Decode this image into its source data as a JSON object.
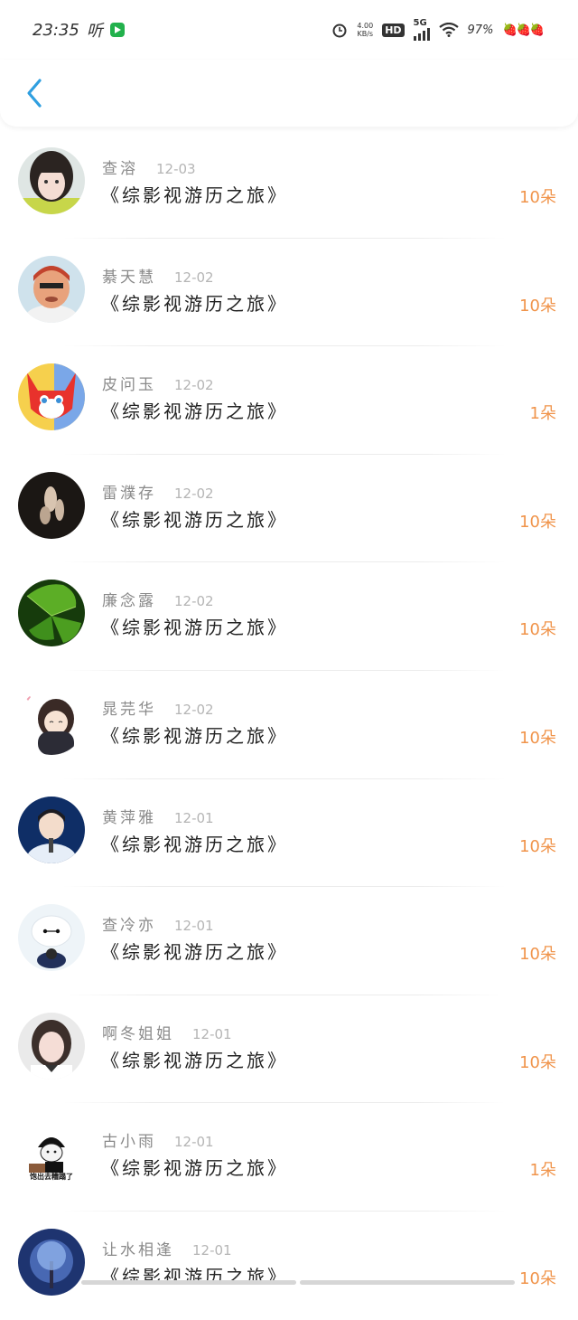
{
  "status_bar": {
    "time": "23:35",
    "listen_label": "听",
    "speed_value": "4.00",
    "speed_unit": "KB/s",
    "hd": "HD",
    "network": "5G",
    "battery": "97%",
    "berries": "🍓🍓🍓"
  },
  "header": {
    "back_icon": "chevron-left-icon"
  },
  "colors": {
    "accent": "#2f9fe0",
    "flowers": "#f0944b"
  },
  "items": [
    {
      "name": "查溶",
      "date": "12-03",
      "book": "《综影视游历之旅》",
      "flowers": "10朵",
      "avatar": "girl-photo"
    },
    {
      "name": "綦天慧",
      "date": "12-02",
      "book": "《综影视游历之旅》",
      "flowers": "10朵",
      "avatar": "cartoon-man"
    },
    {
      "name": "皮问玉",
      "date": "12-02",
      "book": "《综影视游历之旅》",
      "flowers": "1朵",
      "avatar": "red-fox"
    },
    {
      "name": "雷濮存",
      "date": "12-02",
      "book": "《综影视游历之旅》",
      "flowers": "10朵",
      "avatar": "dark-photo"
    },
    {
      "name": "廉念露",
      "date": "12-02",
      "book": "《综影视游历之旅》",
      "flowers": "10朵",
      "avatar": "ginkgo-leaf"
    },
    {
      "name": "晁芫华",
      "date": "12-02",
      "book": "《综影视游历之旅》",
      "flowers": "10朵",
      "avatar": "anime-girl"
    },
    {
      "name": "黄萍雅",
      "date": "12-01",
      "book": "《综影视游历之旅》",
      "flowers": "10朵",
      "avatar": "singer-blue"
    },
    {
      "name": "查冷亦",
      "date": "12-01",
      "book": "《综影视游历之旅》",
      "flowers": "10朵",
      "avatar": "baymax"
    },
    {
      "name": "啊冬姐姐",
      "date": "12-01",
      "book": "《综影视游历之旅》",
      "flowers": "10朵",
      "avatar": "girl-selfie"
    },
    {
      "name": "古小雨",
      "date": "12-01",
      "book": "《综影视游历之旅》",
      "flowers": "1朵",
      "avatar": "meme-head",
      "avatar_caption": "饱出去糟蹋了"
    },
    {
      "name": "让水相逢",
      "date": "12-01",
      "book": "《综影视游历之旅》",
      "flowers": "10朵",
      "avatar": "night-tree"
    }
  ]
}
